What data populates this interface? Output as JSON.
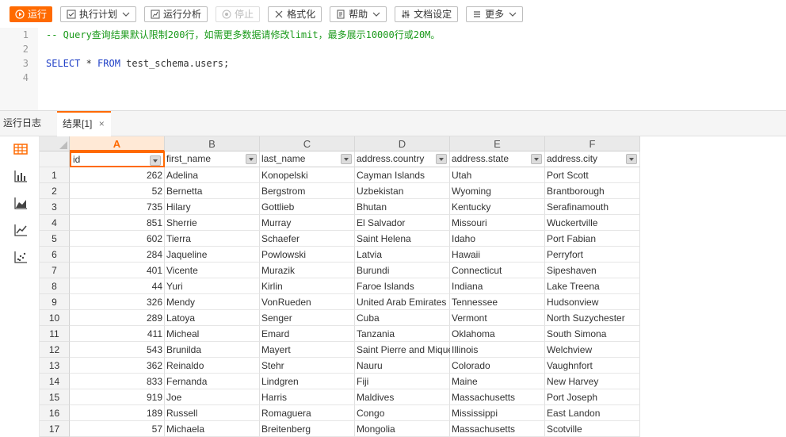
{
  "toolbar": {
    "run_label": "运行",
    "plan_label": "执行计划",
    "analyze_label": "运行分析",
    "stop_label": "停止",
    "format_label": "格式化",
    "help_label": "帮助",
    "settings_label": "文档设定",
    "more_label": "更多"
  },
  "editor": {
    "lines": [
      {
        "num": "1",
        "text": "-- Query查询结果默认限制200行，如需更多数据请修改limit，最多展示10000行或20M。"
      },
      {
        "num": "2",
        "text": ""
      },
      {
        "num": "3",
        "kw1": "SELECT",
        "star": " * ",
        "kw2": "FROM",
        "rest": " test_schema.users;"
      },
      {
        "num": "4",
        "text": ""
      }
    ]
  },
  "tabs": {
    "log": "运行日志",
    "result": "结果[1]"
  },
  "grid": {
    "col_letters": [
      "A",
      "B",
      "C",
      "D",
      "E",
      "F"
    ],
    "fields": [
      "id",
      "first_name",
      "last_name",
      "address.country",
      "address.state",
      "address.city"
    ],
    "rows": [
      [
        "1",
        "262",
        "Adelina",
        "Konopelski",
        "Cayman Islands",
        "Utah",
        "Port Scott"
      ],
      [
        "2",
        "52",
        "Bernetta",
        "Bergstrom",
        "Uzbekistan",
        "Wyoming",
        "Brantborough"
      ],
      [
        "3",
        "735",
        "Hilary",
        "Gottlieb",
        "Bhutan",
        "Kentucky",
        "Serafinamouth"
      ],
      [
        "4",
        "851",
        "Sherrie",
        "Murray",
        "El Salvador",
        "Missouri",
        "Wuckertville"
      ],
      [
        "5",
        "602",
        "Tierra",
        "Schaefer",
        "Saint Helena",
        "Idaho",
        "Port Fabian"
      ],
      [
        "6",
        "284",
        "Jaqueline",
        "Powlowski",
        "Latvia",
        "Hawaii",
        "Perryfort"
      ],
      [
        "7",
        "401",
        "Vicente",
        "Murazik",
        "Burundi",
        "Connecticut",
        "Sipeshaven"
      ],
      [
        "8",
        "44",
        "Yuri",
        "Kirlin",
        "Faroe Islands",
        "Indiana",
        "Lake Treena"
      ],
      [
        "9",
        "326",
        "Mendy",
        "VonRueden",
        "United Arab Emirates",
        "Tennessee",
        "Hudsonview"
      ],
      [
        "10",
        "289",
        "Latoya",
        "Senger",
        "Cuba",
        "Vermont",
        "North Suzychester"
      ],
      [
        "11",
        "411",
        "Micheal",
        "Emard",
        "Tanzania",
        "Oklahoma",
        "South Simona"
      ],
      [
        "12",
        "543",
        "Brunilda",
        "Mayert",
        "Saint Pierre and Miquelon",
        "Illinois",
        "Welchview"
      ],
      [
        "13",
        "362",
        "Reinaldo",
        "Stehr",
        "Nauru",
        "Colorado",
        "Vaughnfort"
      ],
      [
        "14",
        "833",
        "Fernanda",
        "Lindgren",
        "Fiji",
        "Maine",
        "New Harvey"
      ],
      [
        "15",
        "919",
        "Joe",
        "Harris",
        "Maldives",
        "Massachusetts",
        "Port Joseph"
      ],
      [
        "16",
        "189",
        "Russell",
        "Romaguera",
        "Congo",
        "Mississippi",
        "East Landon"
      ],
      [
        "17",
        "57",
        "Michaela",
        "Breitenberg",
        "Mongolia",
        "Massachusetts",
        "Scotville"
      ]
    ]
  },
  "colors": {
    "accent": "#ff6a00",
    "comment": "#1a9a1a",
    "keyword": "#1e3ec6"
  }
}
